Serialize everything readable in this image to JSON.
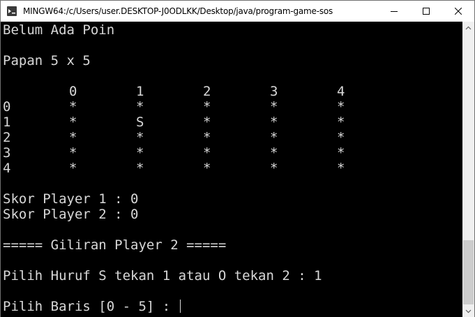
{
  "window": {
    "title": "MINGW64:/c/Users/user.DESKTOP-J0ODLKK/Desktop/java/program-game-sos",
    "icons": {
      "app": "mingw-terminal-icon",
      "minimize": "minimize-icon",
      "maximize": "maximize-icon",
      "close": "close-icon"
    }
  },
  "terminal": {
    "lines": [
      "Belum Ada Poin",
      "",
      "Papan 5 x 5",
      "",
      "",
      "",
      "",
      "",
      "",
      "",
      "",
      "Skor Player 1 : 0",
      "Skor Player 2 : 0",
      "",
      "===== Giliran Player 2 =====",
      "",
      "Pilih Huruf S tekan 1 atau O tekan 2 : 1",
      "",
      "Pilih Baris [0 - 5] : "
    ],
    "board": {
      "column_headers": [
        "0",
        "1",
        "2",
        "3",
        "4"
      ],
      "rows": [
        {
          "label": "0",
          "cells": [
            "*",
            "*",
            "*",
            "*",
            "*"
          ]
        },
        {
          "label": "1",
          "cells": [
            "*",
            "S",
            "*",
            "*",
            "*"
          ]
        },
        {
          "label": "2",
          "cells": [
            "*",
            "*",
            "*",
            "*",
            "*"
          ]
        },
        {
          "label": "3",
          "cells": [
            "*",
            "*",
            "*",
            "*",
            "*"
          ]
        },
        {
          "label": "4",
          "cells": [
            "*",
            "*",
            "*",
            "*",
            "*"
          ]
        }
      ]
    },
    "colors": {
      "background": "#000000",
      "foreground": "#d8d8d8"
    }
  },
  "scrollbar": {
    "up_icon": "scroll-up-arrow-icon",
    "down_icon": "scroll-down-arrow-icon"
  }
}
